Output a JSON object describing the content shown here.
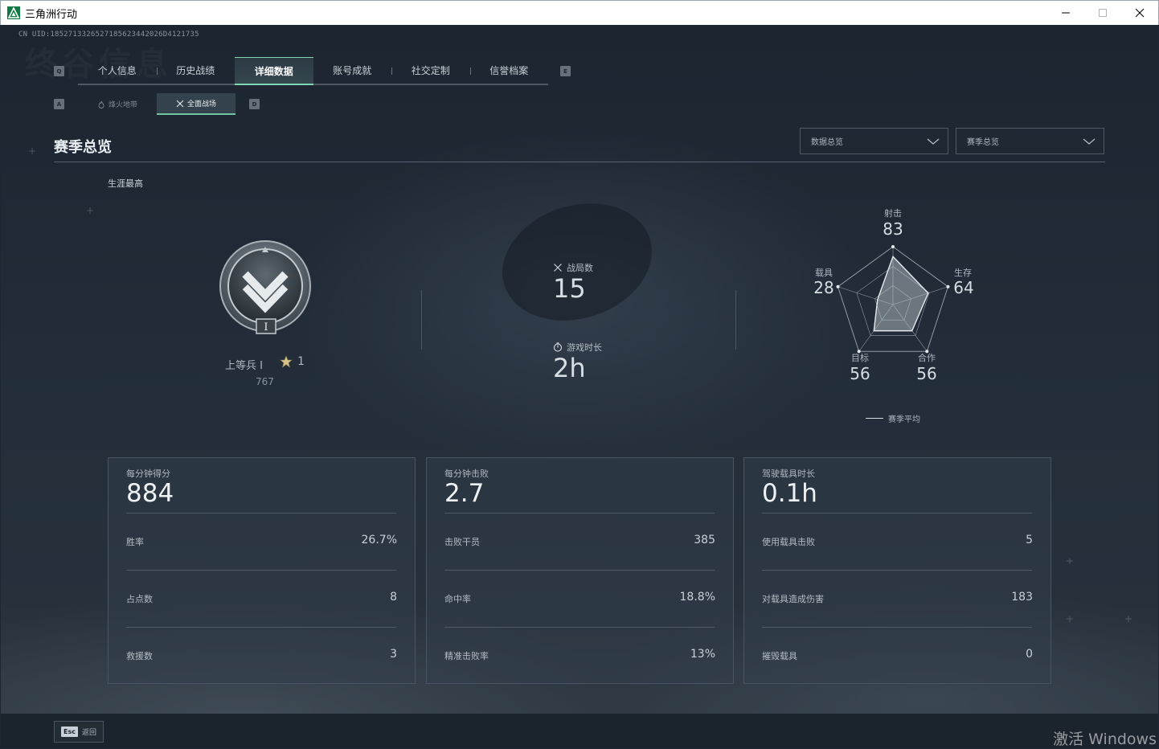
{
  "window": {
    "title": "三角洲行动"
  },
  "uid": "CN UID:1852713326527185623442026D4121735",
  "bg_text": "终谷信息",
  "keyhints": {
    "tab_prev": "Q",
    "tab_next": "E",
    "sub_prev": "A",
    "sub_next": "D"
  },
  "tabs": [
    {
      "label": "个人信息"
    },
    {
      "label": "历史战绩"
    },
    {
      "label": "详细数据"
    },
    {
      "label": "账号成就"
    },
    {
      "label": "社交定制"
    },
    {
      "label": "信誉档案"
    }
  ],
  "subtabs": [
    {
      "label": "烽火地带"
    },
    {
      "label": "全面战场"
    }
  ],
  "section": {
    "title": "赛季总览"
  },
  "dropdowns": [
    {
      "value": "数据总览"
    },
    {
      "value": "赛季总览"
    }
  ],
  "career_label": "生涯最高",
  "rank": {
    "name": "上等兵 I",
    "stars": "1",
    "points": "767",
    "badge_numeral": "I"
  },
  "match_count": {
    "label": "战局数",
    "value": "15"
  },
  "play_time": {
    "label": "游戏时长",
    "value": "2h"
  },
  "radar": {
    "axes": [
      {
        "label": "射击",
        "value": 83
      },
      {
        "label": "生存",
        "value": 64
      },
      {
        "label": "合作",
        "value": 56
      },
      {
        "label": "目标",
        "value": 56
      },
      {
        "label": "载具",
        "value": 28
      }
    ],
    "legend": "赛季平均"
  },
  "cards": [
    {
      "label": "每分钟得分",
      "value": "884",
      "rows": [
        {
          "label": "胜率",
          "value": "26.7%"
        },
        {
          "label": "占点数",
          "value": "8"
        },
        {
          "label": "救援数",
          "value": "3"
        }
      ]
    },
    {
      "label": "每分钟击败",
      "value": "2.7",
      "rows": [
        {
          "label": "击败干员",
          "value": "385"
        },
        {
          "label": "命中率",
          "value": "18.8%"
        },
        {
          "label": "精准击败率",
          "value": "13%"
        }
      ]
    },
    {
      "label": "驾驶载具时长",
      "value": "0.1h",
      "rows": [
        {
          "label": "使用载具击败",
          "value": "5"
        },
        {
          "label": "对载具造成伤害",
          "value": "183"
        },
        {
          "label": "摧毁载具",
          "value": "0"
        }
      ]
    }
  ],
  "footer": {
    "esc_key": "Esc",
    "esc_label": "返回"
  },
  "watermark": "激活 Windows",
  "colors": {
    "accent": "#7fd6b0",
    "bg": "#1d2632",
    "text": "#c9d0d8"
  }
}
